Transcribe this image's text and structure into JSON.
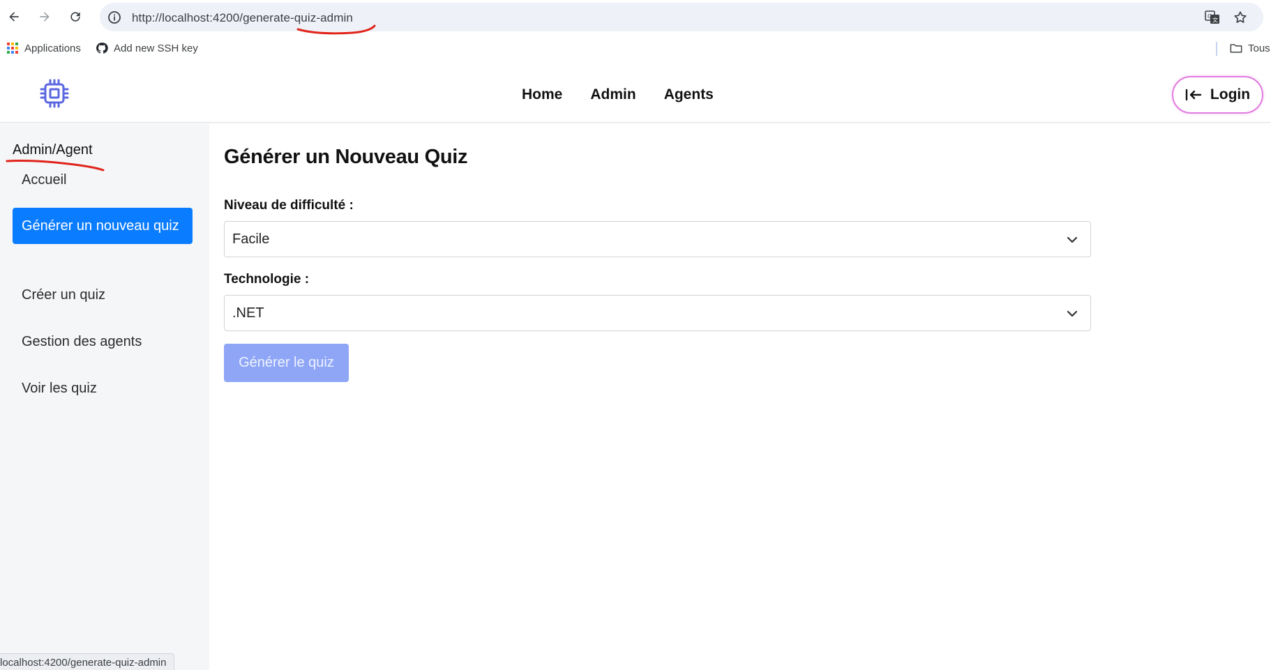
{
  "browser": {
    "url": "http://localhost:4200/generate-quiz-admin",
    "bookmarks": [
      {
        "label": "Applications",
        "icon": "apps-grid-icon"
      },
      {
        "label": "Add new SSH key",
        "icon": "github-icon"
      }
    ],
    "bookmarks_folder_label": "Tous",
    "status_url": "localhost:4200/generate-quiz-admin"
  },
  "header": {
    "nav": [
      "Home",
      "Admin",
      "Agents"
    ],
    "login_label": "Login"
  },
  "sidebar": {
    "title": "Admin/Agent",
    "items": [
      {
        "label": "Accueil",
        "active": false
      },
      {
        "label": "Générer un nouveau quiz",
        "active": true
      },
      {
        "label": "Créer un quiz",
        "active": false
      },
      {
        "label": "Gestion des agents",
        "active": false
      },
      {
        "label": "Voir les quiz",
        "active": false
      }
    ]
  },
  "main": {
    "title": "Générer un Nouveau Quiz",
    "difficulty_label": "Niveau de difficulté :",
    "difficulty_value": "Facile",
    "technology_label": "Technologie :",
    "technology_value": ".NET",
    "generate_button": "Générer le quiz"
  },
  "colors": {
    "accent": "#0a7cff",
    "logo": "#5a67e0",
    "login_border": "#e27ae0",
    "button_disabled": "#8fa6f7",
    "annotation": "#e0241b"
  }
}
